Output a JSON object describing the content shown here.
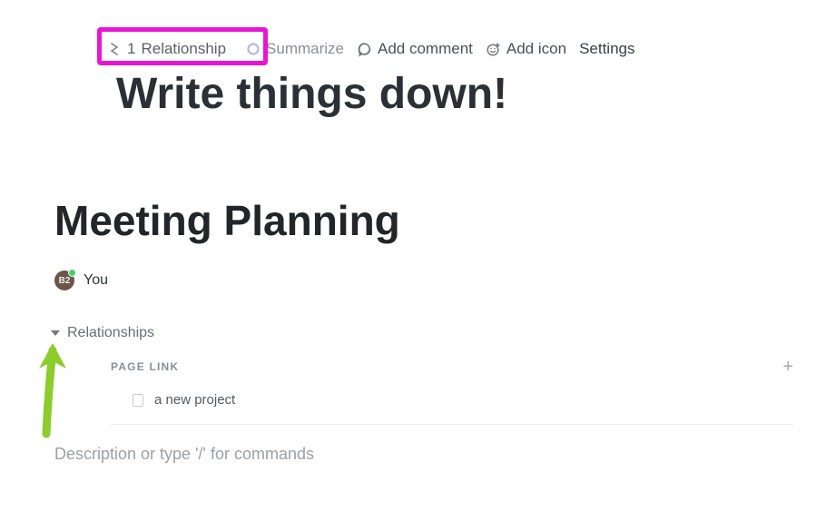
{
  "toolbar": {
    "relationship": {
      "count": "1",
      "label": "Relationship"
    },
    "summarize": "Summarize",
    "add_comment": "Add comment",
    "add_icon": "Add icon",
    "settings": "Settings"
  },
  "banner_title": "Write things down!",
  "page_title": "Meeting Planning",
  "author": {
    "avatar_initials": "B2",
    "name": "You"
  },
  "sections": {
    "relationships": {
      "label": "Relationships",
      "page_link": {
        "heading": "PAGE LINK",
        "items": [
          {
            "title": "a new project"
          }
        ]
      }
    }
  },
  "description": {
    "placeholder": "Description or type '/' for commands"
  },
  "annotations": {
    "highlight_target": "relationship-chip",
    "arrow_color": "#8ccc2c"
  }
}
